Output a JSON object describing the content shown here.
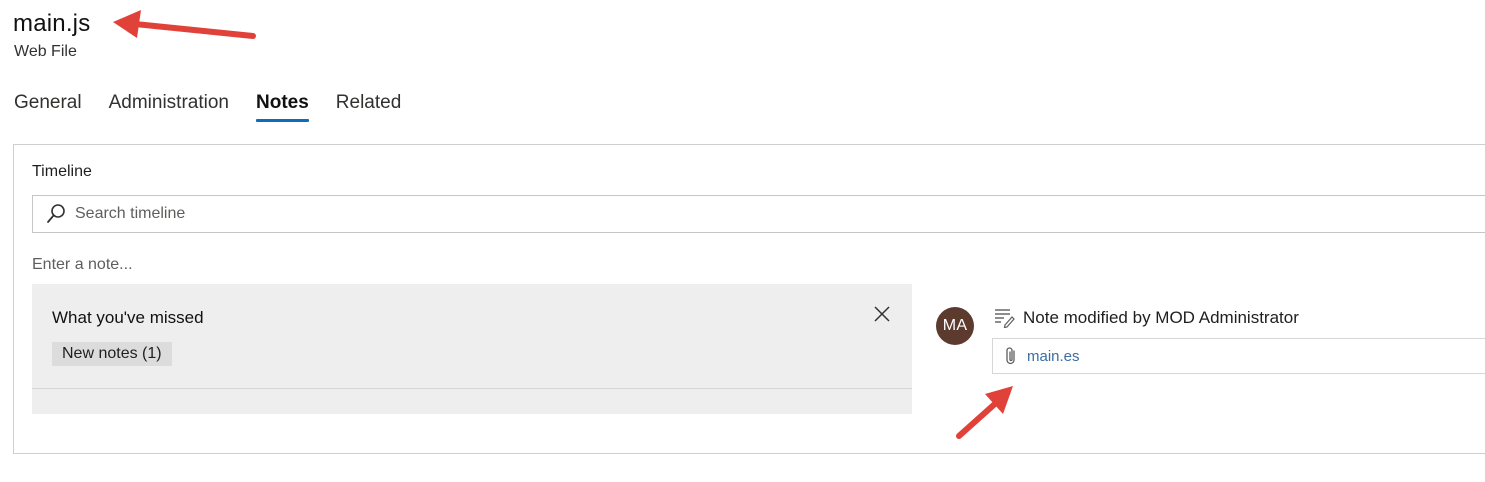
{
  "record": {
    "title": "main.js",
    "type": "Web File"
  },
  "tabs": [
    {
      "label": "General",
      "active": false
    },
    {
      "label": "Administration",
      "active": false
    },
    {
      "label": "Notes",
      "active": true
    },
    {
      "label": "Related",
      "active": false
    }
  ],
  "timeline": {
    "label": "Timeline",
    "search_placeholder": "Search timeline",
    "note_placeholder": "Enter a note...",
    "missed": {
      "title": "What you've missed",
      "new_notes": "New notes (1)"
    },
    "activity": {
      "avatar_initials": "MA",
      "avatar_color": "#5c3a2e",
      "title": "Note modified by MOD Administrator",
      "attachment": "main.es",
      "icons": [
        "note-icon",
        "paperclip-icon"
      ]
    }
  },
  "colors": {
    "accent": "#0f6cbd",
    "annotation_arrow": "#e0423a",
    "link": "#3a6ea5"
  }
}
